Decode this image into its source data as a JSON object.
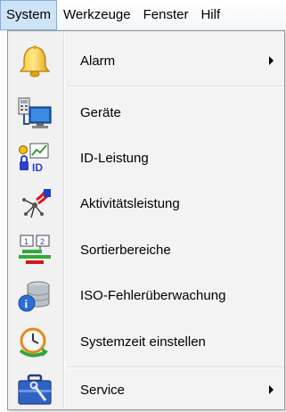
{
  "menubar": {
    "items": [
      "System",
      "Werkzeuge",
      "Fenster",
      "Hilf"
    ]
  },
  "menu": {
    "items": [
      {
        "label": "Alarm",
        "icon": "bell-icon",
        "submenu": true
      },
      {
        "label": "Geräte",
        "icon": "devices-icon",
        "submenu": false
      },
      {
        "label": "ID-Leistung",
        "icon": "id-performance-icon",
        "submenu": false
      },
      {
        "label": "Aktivitätsleistung",
        "icon": "activity-icon",
        "submenu": false
      },
      {
        "label": "Sortierbereiche",
        "icon": "sort-areas-icon",
        "submenu": false
      },
      {
        "label": "ISO-Fehlerüberwachung",
        "icon": "database-info-icon",
        "submenu": false
      },
      {
        "label": "Systemzeit einstellen",
        "icon": "clock-sync-icon",
        "submenu": false
      },
      {
        "label": "Service",
        "icon": "toolbox-icon",
        "submenu": true
      }
    ]
  },
  "colors": {
    "menubar_active_bg": "#cfe3f7",
    "menubar_active_border": "#84acdd",
    "menu_bg": "#f3f3f3"
  }
}
